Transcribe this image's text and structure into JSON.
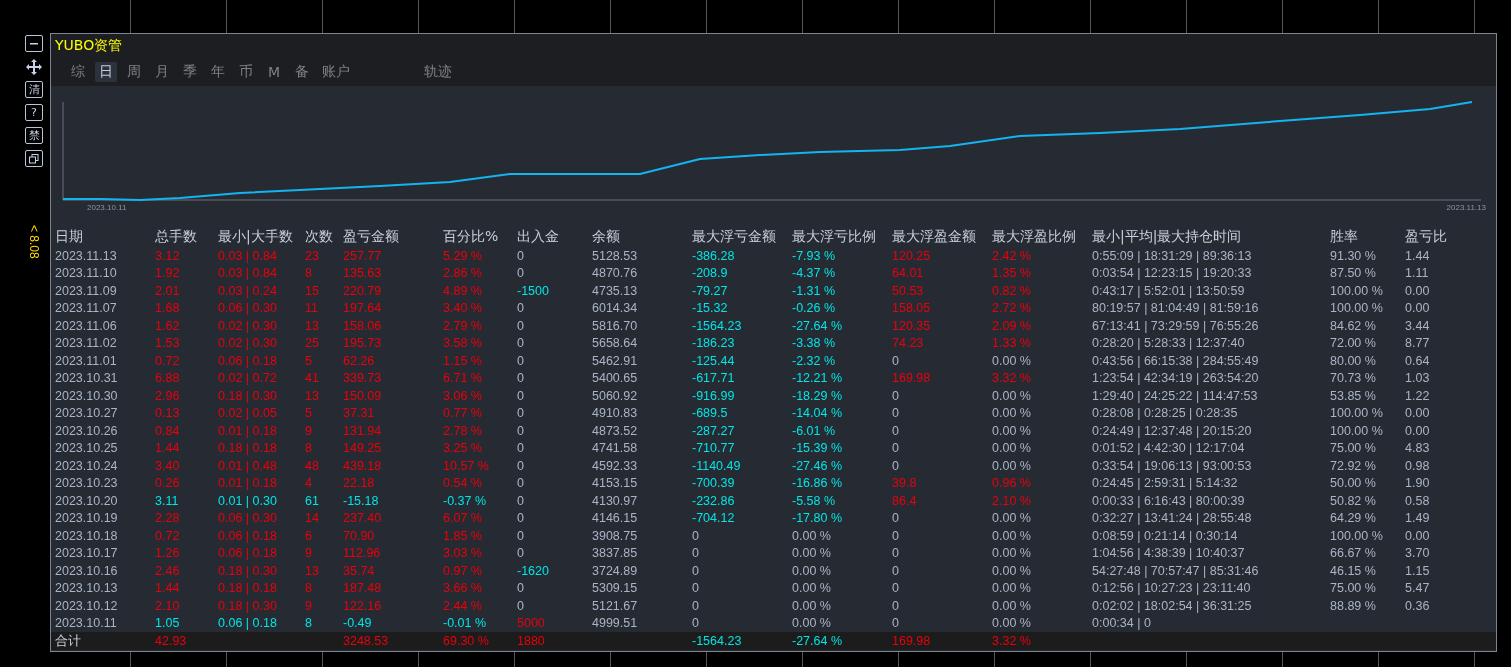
{
  "toolbar": {
    "buttons": [
      {
        "kind": "minus"
      },
      {
        "kind": "move"
      },
      {
        "kind": "glyph",
        "label": "清"
      },
      {
        "kind": "glyph",
        "label": "?"
      },
      {
        "kind": "glyph",
        "label": "禁"
      },
      {
        "kind": "restore"
      }
    ],
    "price_label": "< 8.08"
  },
  "window": {
    "title": "YUBO资管"
  },
  "tabs": [
    {
      "label": "综",
      "selected": false
    },
    {
      "label": "日",
      "selected": true
    },
    {
      "label": "周",
      "selected": false
    },
    {
      "label": "月",
      "selected": false
    },
    {
      "label": "季",
      "selected": false
    },
    {
      "label": "年",
      "selected": false
    },
    {
      "label": "币",
      "selected": false
    },
    {
      "label": "M",
      "selected": false
    },
    {
      "label": "备",
      "selected": false
    },
    {
      "label": "账户",
      "selected": false
    }
  ],
  "trail_tab": {
    "label": "轨迹",
    "selected": false
  },
  "chart": {
    "start_label": "2023.10.11",
    "end_label": "2023.11.13"
  },
  "table": {
    "columns": [
      "日期",
      "总手数",
      "最小|大手数",
      "次数",
      "盈亏金额",
      "百分比%",
      "出入金",
      "余额",
      "最大浮亏金额",
      "最大浮亏比例",
      "最大浮盈金额",
      "最大浮盈比例",
      "最小|平均|最大持仓时间",
      "胜率",
      "盈亏比"
    ],
    "rows": [
      {
        "date": "2023.11.13",
        "lots": {
          "text": "3.12",
          "color": "#e8000b"
        },
        "lot_range": {
          "text": "0.03 | 0.84",
          "color": "#e8000b"
        },
        "trades": {
          "text": "23",
          "color": "#e8000b"
        },
        "pnl": {
          "text": "257.77",
          "color": "#e8000b"
        },
        "pnl_pct": {
          "text": "5.29 %",
          "color": "#e8000b"
        },
        "deposit": {
          "text": "0",
          "color": "#a9b4c6"
        },
        "balance": {
          "text": "5128.53",
          "color": "#a9b4c6"
        },
        "float_loss": {
          "text": "-386.28",
          "color": "#00e5e5"
        },
        "float_loss_pct": {
          "text": "-7.93 %",
          "color": "#00e5e5"
        },
        "float_gain": {
          "text": "120.25",
          "color": "#e8000b"
        },
        "float_gain_pct": {
          "text": "2.42 %",
          "color": "#e8000b"
        },
        "hold_time": {
          "text": "0:55:09 | 18:31:29 | 89:36:13",
          "color": "#a9b4c6"
        },
        "win_rate": {
          "text": "91.30 %",
          "color": "#a9b4c6"
        },
        "pl_ratio": {
          "text": "1.44",
          "color": "#a9b4c6"
        }
      },
      {
        "date": "2023.11.10",
        "lots": {
          "text": "1.92",
          "color": "#e8000b"
        },
        "lot_range": {
          "text": "0.03 | 0.84",
          "color": "#e8000b"
        },
        "trades": {
          "text": "8",
          "color": "#e8000b"
        },
        "pnl": {
          "text": "135.63",
          "color": "#e8000b"
        },
        "pnl_pct": {
          "text": "2.86 %",
          "color": "#e8000b"
        },
        "deposit": {
          "text": "0",
          "color": "#a9b4c6"
        },
        "balance": {
          "text": "4870.76",
          "color": "#a9b4c6"
        },
        "float_loss": {
          "text": "-208.9",
          "color": "#00e5e5"
        },
        "float_loss_pct": {
          "text": "-4.37 %",
          "color": "#00e5e5"
        },
        "float_gain": {
          "text": "64.01",
          "color": "#e8000b"
        },
        "float_gain_pct": {
          "text": "1.35 %",
          "color": "#e8000b"
        },
        "hold_time": {
          "text": "0:03:54 | 12:23:15 | 19:20:33",
          "color": "#a9b4c6"
        },
        "win_rate": {
          "text": "87.50 %",
          "color": "#a9b4c6"
        },
        "pl_ratio": {
          "text": "1.11",
          "color": "#a9b4c6"
        }
      },
      {
        "date": "2023.11.09",
        "lots": {
          "text": "2.01",
          "color": "#e8000b"
        },
        "lot_range": {
          "text": "0.03 | 0.24",
          "color": "#e8000b"
        },
        "trades": {
          "text": "15",
          "color": "#e8000b"
        },
        "pnl": {
          "text": "220.79",
          "color": "#e8000b"
        },
        "pnl_pct": {
          "text": "4.89 %",
          "color": "#e8000b"
        },
        "deposit": {
          "text": "-1500",
          "color": "#00e5e5"
        },
        "balance": {
          "text": "4735.13",
          "color": "#a9b4c6"
        },
        "float_loss": {
          "text": "-79.27",
          "color": "#00e5e5"
        },
        "float_loss_pct": {
          "text": "-1.31 %",
          "color": "#00e5e5"
        },
        "float_gain": {
          "text": "50.53",
          "color": "#e8000b"
        },
        "float_gain_pct": {
          "text": "0.82 %",
          "color": "#e8000b"
        },
        "hold_time": {
          "text": "0:43:17 | 5:52:01 | 13:50:59",
          "color": "#a9b4c6"
        },
        "win_rate": {
          "text": "100.00 %",
          "color": "#a9b4c6"
        },
        "pl_ratio": {
          "text": "0.00",
          "color": "#a9b4c6"
        }
      },
      {
        "date": "2023.11.07",
        "lots": {
          "text": "1.68",
          "color": "#e8000b"
        },
        "lot_range": {
          "text": "0.06 | 0.30",
          "color": "#e8000b"
        },
        "trades": {
          "text": "11",
          "color": "#e8000b"
        },
        "pnl": {
          "text": "197.64",
          "color": "#e8000b"
        },
        "pnl_pct": {
          "text": "3.40 %",
          "color": "#e8000b"
        },
        "deposit": {
          "text": "0",
          "color": "#a9b4c6"
        },
        "balance": {
          "text": "6014.34",
          "color": "#a9b4c6"
        },
        "float_loss": {
          "text": "-15.32",
          "color": "#00e5e5"
        },
        "float_loss_pct": {
          "text": "-0.26 %",
          "color": "#00e5e5"
        },
        "float_gain": {
          "text": "158.05",
          "color": "#e8000b"
        },
        "float_gain_pct": {
          "text": "2.72 %",
          "color": "#e8000b"
        },
        "hold_time": {
          "text": "80:19:57 | 81:04:49 | 81:59:16",
          "color": "#a9b4c6"
        },
        "win_rate": {
          "text": "100.00 %",
          "color": "#a9b4c6"
        },
        "pl_ratio": {
          "text": "0.00",
          "color": "#a9b4c6"
        }
      },
      {
        "date": "2023.11.06",
        "lots": {
          "text": "1.62",
          "color": "#e8000b"
        },
        "lot_range": {
          "text": "0.02 | 0.30",
          "color": "#e8000b"
        },
        "trades": {
          "text": "13",
          "color": "#e8000b"
        },
        "pnl": {
          "text": "158.06",
          "color": "#e8000b"
        },
        "pnl_pct": {
          "text": "2.79 %",
          "color": "#e8000b"
        },
        "deposit": {
          "text": "0",
          "color": "#a9b4c6"
        },
        "balance": {
          "text": "5816.70",
          "color": "#a9b4c6"
        },
        "float_loss": {
          "text": "-1564.23",
          "color": "#00e5e5"
        },
        "float_loss_pct": {
          "text": "-27.64 %",
          "color": "#00e5e5"
        },
        "float_gain": {
          "text": "120.35",
          "color": "#e8000b"
        },
        "float_gain_pct": {
          "text": "2.09 %",
          "color": "#e8000b"
        },
        "hold_time": {
          "text": "67:13:41 | 73:29:59 | 76:55:26",
          "color": "#a9b4c6"
        },
        "win_rate": {
          "text": "84.62 %",
          "color": "#a9b4c6"
        },
        "pl_ratio": {
          "text": "3.44",
          "color": "#a9b4c6"
        }
      },
      {
        "date": "2023.11.02",
        "lots": {
          "text": "1.53",
          "color": "#e8000b"
        },
        "lot_range": {
          "text": "0.02 | 0.30",
          "color": "#e8000b"
        },
        "trades": {
          "text": "25",
          "color": "#e8000b"
        },
        "pnl": {
          "text": "195.73",
          "color": "#e8000b"
        },
        "pnl_pct": {
          "text": "3.58 %",
          "color": "#e8000b"
        },
        "deposit": {
          "text": "0",
          "color": "#a9b4c6"
        },
        "balance": {
          "text": "5658.64",
          "color": "#a9b4c6"
        },
        "float_loss": {
          "text": "-186.23",
          "color": "#00e5e5"
        },
        "float_loss_pct": {
          "text": "-3.38 %",
          "color": "#00e5e5"
        },
        "float_gain": {
          "text": "74.23",
          "color": "#e8000b"
        },
        "float_gain_pct": {
          "text": "1.33 %",
          "color": "#e8000b"
        },
        "hold_time": {
          "text": "0:28:20 | 5:28:33 | 12:37:40",
          "color": "#a9b4c6"
        },
        "win_rate": {
          "text": "72.00 %",
          "color": "#a9b4c6"
        },
        "pl_ratio": {
          "text": "8.77",
          "color": "#a9b4c6"
        }
      },
      {
        "date": "2023.11.01",
        "lots": {
          "text": "0.72",
          "color": "#e8000b"
        },
        "lot_range": {
          "text": "0.06 | 0.18",
          "color": "#e8000b"
        },
        "trades": {
          "text": "5",
          "color": "#e8000b"
        },
        "pnl": {
          "text": "62.26",
          "color": "#e8000b"
        },
        "pnl_pct": {
          "text": "1.15 %",
          "color": "#e8000b"
        },
        "deposit": {
          "text": "0",
          "color": "#a9b4c6"
        },
        "balance": {
          "text": "5462.91",
          "color": "#a9b4c6"
        },
        "float_loss": {
          "text": "-125.44",
          "color": "#00e5e5"
        },
        "float_loss_pct": {
          "text": "-2.32 %",
          "color": "#00e5e5"
        },
        "float_gain": {
          "text": "0",
          "color": "#a9b4c6"
        },
        "float_gain_pct": {
          "text": "0.00 %",
          "color": "#a9b4c6"
        },
        "hold_time": {
          "text": "0:43:56 | 66:15:38 | 284:55:49",
          "color": "#a9b4c6"
        },
        "win_rate": {
          "text": "80.00 %",
          "color": "#a9b4c6"
        },
        "pl_ratio": {
          "text": "0.64",
          "color": "#a9b4c6"
        }
      },
      {
        "date": "2023.10.31",
        "lots": {
          "text": "6.88",
          "color": "#e8000b"
        },
        "lot_range": {
          "text": "0.02 | 0.72",
          "color": "#e8000b"
        },
        "trades": {
          "text": "41",
          "color": "#e8000b"
        },
        "pnl": {
          "text": "339.73",
          "color": "#e8000b"
        },
        "pnl_pct": {
          "text": "6.71 %",
          "color": "#e8000b"
        },
        "deposit": {
          "text": "0",
          "color": "#a9b4c6"
        },
        "balance": {
          "text": "5400.65",
          "color": "#a9b4c6"
        },
        "float_loss": {
          "text": "-617.71",
          "color": "#00e5e5"
        },
        "float_loss_pct": {
          "text": "-12.21 %",
          "color": "#00e5e5"
        },
        "float_gain": {
          "text": "169.98",
          "color": "#e8000b"
        },
        "float_gain_pct": {
          "text": "3.32 %",
          "color": "#e8000b"
        },
        "hold_time": {
          "text": "1:23:54 | 42:34:19 | 263:54:20",
          "color": "#a9b4c6"
        },
        "win_rate": {
          "text": "70.73 %",
          "color": "#a9b4c6"
        },
        "pl_ratio": {
          "text": "1.03",
          "color": "#a9b4c6"
        }
      },
      {
        "date": "2023.10.30",
        "lots": {
          "text": "2.96",
          "color": "#e8000b"
        },
        "lot_range": {
          "text": "0.18 | 0.30",
          "color": "#e8000b"
        },
        "trades": {
          "text": "13",
          "color": "#e8000b"
        },
        "pnl": {
          "text": "150.09",
          "color": "#e8000b"
        },
        "pnl_pct": {
          "text": "3.06 %",
          "color": "#e8000b"
        },
        "deposit": {
          "text": "0",
          "color": "#a9b4c6"
        },
        "balance": {
          "text": "5060.92",
          "color": "#a9b4c6"
        },
        "float_loss": {
          "text": "-916.99",
          "color": "#00e5e5"
        },
        "float_loss_pct": {
          "text": "-18.29 %",
          "color": "#00e5e5"
        },
        "float_gain": {
          "text": "0",
          "color": "#a9b4c6"
        },
        "float_gain_pct": {
          "text": "0.00 %",
          "color": "#a9b4c6"
        },
        "hold_time": {
          "text": "1:29:40 | 24:25:22 | 114:47:53",
          "color": "#a9b4c6"
        },
        "win_rate": {
          "text": "53.85 %",
          "color": "#a9b4c6"
        },
        "pl_ratio": {
          "text": "1.22",
          "color": "#a9b4c6"
        }
      },
      {
        "date": "2023.10.27",
        "lots": {
          "text": "0.13",
          "color": "#e8000b"
        },
        "lot_range": {
          "text": "0.02 | 0.05",
          "color": "#e8000b"
        },
        "trades": {
          "text": "5",
          "color": "#e8000b"
        },
        "pnl": {
          "text": "37.31",
          "color": "#e8000b"
        },
        "pnl_pct": {
          "text": "0.77 %",
          "color": "#e8000b"
        },
        "deposit": {
          "text": "0",
          "color": "#a9b4c6"
        },
        "balance": {
          "text": "4910.83",
          "color": "#a9b4c6"
        },
        "float_loss": {
          "text": "-689.5",
          "color": "#00e5e5"
        },
        "float_loss_pct": {
          "text": "-14.04 %",
          "color": "#00e5e5"
        },
        "float_gain": {
          "text": "0",
          "color": "#a9b4c6"
        },
        "float_gain_pct": {
          "text": "0.00 %",
          "color": "#a9b4c6"
        },
        "hold_time": {
          "text": "0:28:08 | 0:28:25 | 0:28:35",
          "color": "#a9b4c6"
        },
        "win_rate": {
          "text": "100.00 %",
          "color": "#a9b4c6"
        },
        "pl_ratio": {
          "text": "0.00",
          "color": "#a9b4c6"
        }
      },
      {
        "date": "2023.10.26",
        "lots": {
          "text": "0.84",
          "color": "#e8000b"
        },
        "lot_range": {
          "text": "0.01 | 0.18",
          "color": "#e8000b"
        },
        "trades": {
          "text": "9",
          "color": "#e8000b"
        },
        "pnl": {
          "text": "131.94",
          "color": "#e8000b"
        },
        "pnl_pct": {
          "text": "2.78 %",
          "color": "#e8000b"
        },
        "deposit": {
          "text": "0",
          "color": "#a9b4c6"
        },
        "balance": {
          "text": "4873.52",
          "color": "#a9b4c6"
        },
        "float_loss": {
          "text": "-287.27",
          "color": "#00e5e5"
        },
        "float_loss_pct": {
          "text": "-6.01 %",
          "color": "#00e5e5"
        },
        "float_gain": {
          "text": "0",
          "color": "#a9b4c6"
        },
        "float_gain_pct": {
          "text": "0.00 %",
          "color": "#a9b4c6"
        },
        "hold_time": {
          "text": "0:24:49 | 12:37:48 | 20:15:20",
          "color": "#a9b4c6"
        },
        "win_rate": {
          "text": "100.00 %",
          "color": "#a9b4c6"
        },
        "pl_ratio": {
          "text": "0.00",
          "color": "#a9b4c6"
        }
      },
      {
        "date": "2023.10.25",
        "lots": {
          "text": "1.44",
          "color": "#e8000b"
        },
        "lot_range": {
          "text": "0.18 | 0.18",
          "color": "#e8000b"
        },
        "trades": {
          "text": "8",
          "color": "#e8000b"
        },
        "pnl": {
          "text": "149.25",
          "color": "#e8000b"
        },
        "pnl_pct": {
          "text": "3.25 %",
          "color": "#e8000b"
        },
        "deposit": {
          "text": "0",
          "color": "#a9b4c6"
        },
        "balance": {
          "text": "4741.58",
          "color": "#a9b4c6"
        },
        "float_loss": {
          "text": "-710.77",
          "color": "#00e5e5"
        },
        "float_loss_pct": {
          "text": "-15.39 %",
          "color": "#00e5e5"
        },
        "float_gain": {
          "text": "0",
          "color": "#a9b4c6"
        },
        "float_gain_pct": {
          "text": "0.00 %",
          "color": "#a9b4c6"
        },
        "hold_time": {
          "text": "0:01:52 | 4:42:30 | 12:17:04",
          "color": "#a9b4c6"
        },
        "win_rate": {
          "text": "75.00 %",
          "color": "#a9b4c6"
        },
        "pl_ratio": {
          "text": "4.83",
          "color": "#a9b4c6"
        }
      },
      {
        "date": "2023.10.24",
        "lots": {
          "text": "3.40",
          "color": "#e8000b"
        },
        "lot_range": {
          "text": "0.01 | 0.48",
          "color": "#e8000b"
        },
        "trades": {
          "text": "48",
          "color": "#e8000b"
        },
        "pnl": {
          "text": "439.18",
          "color": "#e8000b"
        },
        "pnl_pct": {
          "text": "10.57 %",
          "color": "#e8000b"
        },
        "deposit": {
          "text": "0",
          "color": "#a9b4c6"
        },
        "balance": {
          "text": "4592.33",
          "color": "#a9b4c6"
        },
        "float_loss": {
          "text": "-1140.49",
          "color": "#00e5e5"
        },
        "float_loss_pct": {
          "text": "-27.46 %",
          "color": "#00e5e5"
        },
        "float_gain": {
          "text": "0",
          "color": "#a9b4c6"
        },
        "float_gain_pct": {
          "text": "0.00 %",
          "color": "#a9b4c6"
        },
        "hold_time": {
          "text": "0:33:54 | 19:06:13 | 93:00:53",
          "color": "#a9b4c6"
        },
        "win_rate": {
          "text": "72.92 %",
          "color": "#a9b4c6"
        },
        "pl_ratio": {
          "text": "0.98",
          "color": "#a9b4c6"
        }
      },
      {
        "date": "2023.10.23",
        "lots": {
          "text": "0.26",
          "color": "#e8000b"
        },
        "lot_range": {
          "text": "0.01 | 0.18",
          "color": "#e8000b"
        },
        "trades": {
          "text": "4",
          "color": "#e8000b"
        },
        "pnl": {
          "text": "22.18",
          "color": "#e8000b"
        },
        "pnl_pct": {
          "text": "0.54 %",
          "color": "#e8000b"
        },
        "deposit": {
          "text": "0",
          "color": "#a9b4c6"
        },
        "balance": {
          "text": "4153.15",
          "color": "#a9b4c6"
        },
        "float_loss": {
          "text": "-700.39",
          "color": "#00e5e5"
        },
        "float_loss_pct": {
          "text": "-16.86 %",
          "color": "#00e5e5"
        },
        "float_gain": {
          "text": "39.8",
          "color": "#e8000b"
        },
        "float_gain_pct": {
          "text": "0.96 %",
          "color": "#e8000b"
        },
        "hold_time": {
          "text": "0:24:45 | 2:59:31 | 5:14:32",
          "color": "#a9b4c6"
        },
        "win_rate": {
          "text": "50.00 %",
          "color": "#a9b4c6"
        },
        "pl_ratio": {
          "text": "1.90",
          "color": "#a9b4c6"
        }
      },
      {
        "date": "2023.10.20",
        "lots": {
          "text": "3.11",
          "color": "#00e5e5"
        },
        "lot_range": {
          "text": "0.01 | 0.30",
          "color": "#00e5e5"
        },
        "trades": {
          "text": "61",
          "color": "#00e5e5"
        },
        "pnl": {
          "text": "-15.18",
          "color": "#00e5e5"
        },
        "pnl_pct": {
          "text": "-0.37 %",
          "color": "#00e5e5"
        },
        "deposit": {
          "text": "0",
          "color": "#a9b4c6"
        },
        "balance": {
          "text": "4130.97",
          "color": "#a9b4c6"
        },
        "float_loss": {
          "text": "-232.86",
          "color": "#00e5e5"
        },
        "float_loss_pct": {
          "text": "-5.58 %",
          "color": "#00e5e5"
        },
        "float_gain": {
          "text": "86.4",
          "color": "#e8000b"
        },
        "float_gain_pct": {
          "text": "2.10 %",
          "color": "#e8000b"
        },
        "hold_time": {
          "text": "0:00:33 | 6:16:43 | 80:00:39",
          "color": "#a9b4c6"
        },
        "win_rate": {
          "text": "50.82 %",
          "color": "#a9b4c6"
        },
        "pl_ratio": {
          "text": "0.58",
          "color": "#a9b4c6"
        }
      },
      {
        "date": "2023.10.19",
        "lots": {
          "text": "2.28",
          "color": "#e8000b"
        },
        "lot_range": {
          "text": "0.06 | 0.30",
          "color": "#e8000b"
        },
        "trades": {
          "text": "14",
          "color": "#e8000b"
        },
        "pnl": {
          "text": "237.40",
          "color": "#e8000b"
        },
        "pnl_pct": {
          "text": "6.07 %",
          "color": "#e8000b"
        },
        "deposit": {
          "text": "0",
          "color": "#a9b4c6"
        },
        "balance": {
          "text": "4146.15",
          "color": "#a9b4c6"
        },
        "float_loss": {
          "text": "-704.12",
          "color": "#00e5e5"
        },
        "float_loss_pct": {
          "text": "-17.80 %",
          "color": "#00e5e5"
        },
        "float_gain": {
          "text": "0",
          "color": "#a9b4c6"
        },
        "float_gain_pct": {
          "text": "0.00 %",
          "color": "#a9b4c6"
        },
        "hold_time": {
          "text": "0:32:27 | 13:41:24 | 28:55:48",
          "color": "#a9b4c6"
        },
        "win_rate": {
          "text": "64.29 %",
          "color": "#a9b4c6"
        },
        "pl_ratio": {
          "text": "1.49",
          "color": "#a9b4c6"
        }
      },
      {
        "date": "2023.10.18",
        "lots": {
          "text": "0.72",
          "color": "#e8000b"
        },
        "lot_range": {
          "text": "0.06 | 0.18",
          "color": "#e8000b"
        },
        "trades": {
          "text": "6",
          "color": "#e8000b"
        },
        "pnl": {
          "text": "70.90",
          "color": "#e8000b"
        },
        "pnl_pct": {
          "text": "1.85 %",
          "color": "#e8000b"
        },
        "deposit": {
          "text": "0",
          "color": "#a9b4c6"
        },
        "balance": {
          "text": "3908.75",
          "color": "#a9b4c6"
        },
        "float_loss": {
          "text": "0",
          "color": "#a9b4c6"
        },
        "float_loss_pct": {
          "text": "0.00 %",
          "color": "#a9b4c6"
        },
        "float_gain": {
          "text": "0",
          "color": "#a9b4c6"
        },
        "float_gain_pct": {
          "text": "0.00 %",
          "color": "#a9b4c6"
        },
        "hold_time": {
          "text": "0:08:59 | 0:21:14 | 0:30:14",
          "color": "#a9b4c6"
        },
        "win_rate": {
          "text": "100.00 %",
          "color": "#a9b4c6"
        },
        "pl_ratio": {
          "text": "0.00",
          "color": "#a9b4c6"
        }
      },
      {
        "date": "2023.10.17",
        "lots": {
          "text": "1.26",
          "color": "#e8000b"
        },
        "lot_range": {
          "text": "0.06 | 0.18",
          "color": "#e8000b"
        },
        "trades": {
          "text": "9",
          "color": "#e8000b"
        },
        "pnl": {
          "text": "112.96",
          "color": "#e8000b"
        },
        "pnl_pct": {
          "text": "3.03 %",
          "color": "#e8000b"
        },
        "deposit": {
          "text": "0",
          "color": "#a9b4c6"
        },
        "balance": {
          "text": "3837.85",
          "color": "#a9b4c6"
        },
        "float_loss": {
          "text": "0",
          "color": "#a9b4c6"
        },
        "float_loss_pct": {
          "text": "0.00 %",
          "color": "#a9b4c6"
        },
        "float_gain": {
          "text": "0",
          "color": "#a9b4c6"
        },
        "float_gain_pct": {
          "text": "0.00 %",
          "color": "#a9b4c6"
        },
        "hold_time": {
          "text": "1:04:56 | 4:38:39 | 10:40:37",
          "color": "#a9b4c6"
        },
        "win_rate": {
          "text": "66.67 %",
          "color": "#a9b4c6"
        },
        "pl_ratio": {
          "text": "3.70",
          "color": "#a9b4c6"
        }
      },
      {
        "date": "2023.10.16",
        "lots": {
          "text": "2.46",
          "color": "#e8000b"
        },
        "lot_range": {
          "text": "0.18 | 0.30",
          "color": "#e8000b"
        },
        "trades": {
          "text": "13",
          "color": "#e8000b"
        },
        "pnl": {
          "text": "35.74",
          "color": "#e8000b"
        },
        "pnl_pct": {
          "text": "0.97 %",
          "color": "#e8000b"
        },
        "deposit": {
          "text": "-1620",
          "color": "#00e5e5"
        },
        "balance": {
          "text": "3724.89",
          "color": "#a9b4c6"
        },
        "float_loss": {
          "text": "0",
          "color": "#a9b4c6"
        },
        "float_loss_pct": {
          "text": "0.00 %",
          "color": "#a9b4c6"
        },
        "float_gain": {
          "text": "0",
          "color": "#a9b4c6"
        },
        "float_gain_pct": {
          "text": "0.00 %",
          "color": "#a9b4c6"
        },
        "hold_time": {
          "text": "54:27:48 | 70:57:47 | 85:31:46",
          "color": "#a9b4c6"
        },
        "win_rate": {
          "text": "46.15 %",
          "color": "#a9b4c6"
        },
        "pl_ratio": {
          "text": "1.15",
          "color": "#a9b4c6"
        }
      },
      {
        "date": "2023.10.13",
        "lots": {
          "text": "1.44",
          "color": "#e8000b"
        },
        "lot_range": {
          "text": "0.18 | 0.18",
          "color": "#e8000b"
        },
        "trades": {
          "text": "8",
          "color": "#e8000b"
        },
        "pnl": {
          "text": "187.48",
          "color": "#e8000b"
        },
        "pnl_pct": {
          "text": "3.66 %",
          "color": "#e8000b"
        },
        "deposit": {
          "text": "0",
          "color": "#a9b4c6"
        },
        "balance": {
          "text": "5309.15",
          "color": "#a9b4c6"
        },
        "float_loss": {
          "text": "0",
          "color": "#a9b4c6"
        },
        "float_loss_pct": {
          "text": "0.00 %",
          "color": "#a9b4c6"
        },
        "float_gain": {
          "text": "0",
          "color": "#a9b4c6"
        },
        "float_gain_pct": {
          "text": "0.00 %",
          "color": "#a9b4c6"
        },
        "hold_time": {
          "text": "0:12:56 | 10:27:23 | 23:11:40",
          "color": "#a9b4c6"
        },
        "win_rate": {
          "text": "75.00 %",
          "color": "#a9b4c6"
        },
        "pl_ratio": {
          "text": "5.47",
          "color": "#a9b4c6"
        }
      },
      {
        "date": "2023.10.12",
        "lots": {
          "text": "2.10",
          "color": "#e8000b"
        },
        "lot_range": {
          "text": "0.18 | 0.30",
          "color": "#e8000b"
        },
        "trades": {
          "text": "9",
          "color": "#e8000b"
        },
        "pnl": {
          "text": "122.16",
          "color": "#e8000b"
        },
        "pnl_pct": {
          "text": "2.44 %",
          "color": "#e8000b"
        },
        "deposit": {
          "text": "0",
          "color": "#a9b4c6"
        },
        "balance": {
          "text": "5121.67",
          "color": "#a9b4c6"
        },
        "float_loss": {
          "text": "0",
          "color": "#a9b4c6"
        },
        "float_loss_pct": {
          "text": "0.00 %",
          "color": "#a9b4c6"
        },
        "float_gain": {
          "text": "0",
          "color": "#a9b4c6"
        },
        "float_gain_pct": {
          "text": "0.00 %",
          "color": "#a9b4c6"
        },
        "hold_time": {
          "text": "0:02:02 | 18:02:54 | 36:31:25",
          "color": "#a9b4c6"
        },
        "win_rate": {
          "text": "88.89 %",
          "color": "#a9b4c6"
        },
        "pl_ratio": {
          "text": "0.36",
          "color": "#a9b4c6"
        }
      },
      {
        "date": "2023.10.11",
        "lots": {
          "text": "1.05",
          "color": "#00e5e5"
        },
        "lot_range": {
          "text": "0.06 | 0.18",
          "color": "#00e5e5"
        },
        "trades": {
          "text": "8",
          "color": "#00e5e5"
        },
        "pnl": {
          "text": "-0.49",
          "color": "#00e5e5"
        },
        "pnl_pct": {
          "text": "-0.01 %",
          "color": "#00e5e5"
        },
        "deposit": {
          "text": "5000",
          "color": "#e8000b"
        },
        "balance": {
          "text": "4999.51",
          "color": "#a9b4c6"
        },
        "float_loss": {
          "text": "0",
          "color": "#a9b4c6"
        },
        "float_loss_pct": {
          "text": "0.00 %",
          "color": "#a9b4c6"
        },
        "float_gain": {
          "text": "0",
          "color": "#a9b4c6"
        },
        "float_gain_pct": {
          "text": "0.00 %",
          "color": "#a9b4c6"
        },
        "hold_time": {
          "text": "0:00:34 | 0",
          "color": "#a9b4c6"
        }
      }
    ],
    "total": {
      "label": "合计",
      "lots": {
        "text": "42.93",
        "color": "#e8000b"
      },
      "pnl": {
        "text": "3248.53",
        "color": "#e8000b"
      },
      "pnl_pct": {
        "text": "69.30 %",
        "color": "#e8000b"
      },
      "deposit": {
        "text": "1880",
        "color": "#e8000b"
      },
      "float_loss": {
        "text": "-1564.23",
        "color": "#00e5e5"
      },
      "float_loss_pct": {
        "text": "-27.64 %",
        "color": "#00e5e5"
      },
      "float_gain": {
        "text": "169.98",
        "color": "#e8000b"
      },
      "float_gain_pct": {
        "text": "3.32 %",
        "color": "#e8000b"
      }
    }
  }
}
